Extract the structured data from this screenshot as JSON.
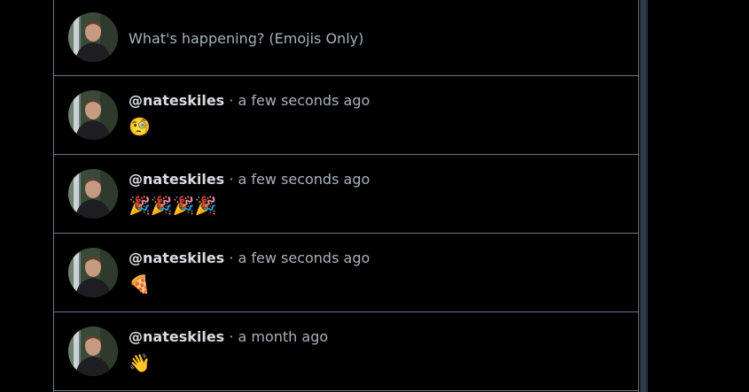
{
  "composer": {
    "placeholder": "What's happening? (Emojis Only)"
  },
  "posts": [
    {
      "handle": "@nateskiles",
      "separator": "·",
      "time": "a few seconds ago",
      "content": "🧐"
    },
    {
      "handle": "@nateskiles",
      "separator": "·",
      "time": "a few seconds ago",
      "content": "🎉🎉🎉🎉"
    },
    {
      "handle": "@nateskiles",
      "separator": "·",
      "time": "a few seconds ago",
      "content": "🍕"
    },
    {
      "handle": "@nateskiles",
      "separator": "·",
      "time": "a month ago",
      "content": "👋"
    }
  ],
  "colors": {
    "background": "#000000",
    "border": "#6e7681",
    "handle": "#d7dce2",
    "muted": "#a9b1bb",
    "scrollbar": "#1f2630"
  }
}
